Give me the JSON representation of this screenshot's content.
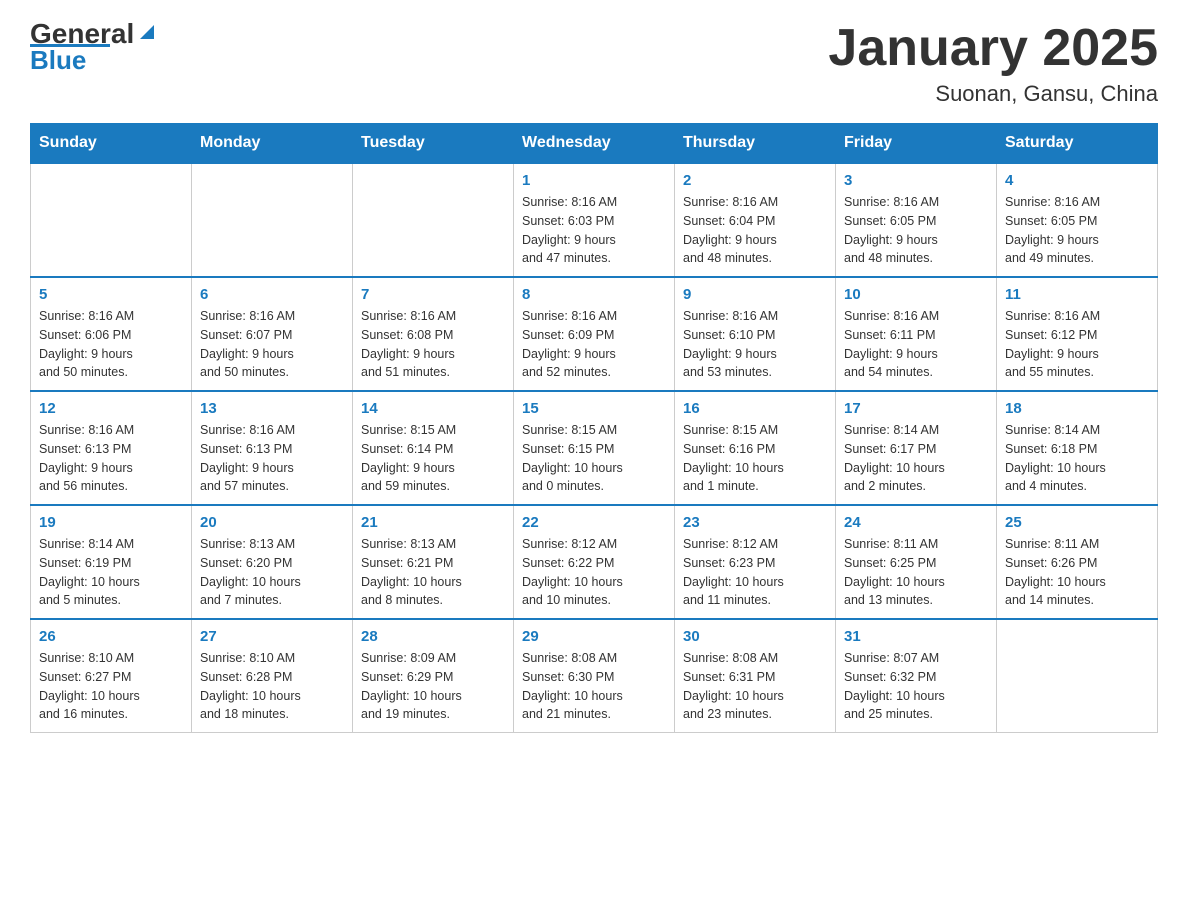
{
  "logo": {
    "text_general": "General",
    "text_blue": "Blue"
  },
  "title": "January 2025",
  "subtitle": "Suonan, Gansu, China",
  "weekdays": [
    "Sunday",
    "Monday",
    "Tuesday",
    "Wednesday",
    "Thursday",
    "Friday",
    "Saturday"
  ],
  "weeks": [
    [
      {
        "day": "",
        "info": ""
      },
      {
        "day": "",
        "info": ""
      },
      {
        "day": "",
        "info": ""
      },
      {
        "day": "1",
        "info": "Sunrise: 8:16 AM\nSunset: 6:03 PM\nDaylight: 9 hours\nand 47 minutes."
      },
      {
        "day": "2",
        "info": "Sunrise: 8:16 AM\nSunset: 6:04 PM\nDaylight: 9 hours\nand 48 minutes."
      },
      {
        "day": "3",
        "info": "Sunrise: 8:16 AM\nSunset: 6:05 PM\nDaylight: 9 hours\nand 48 minutes."
      },
      {
        "day": "4",
        "info": "Sunrise: 8:16 AM\nSunset: 6:05 PM\nDaylight: 9 hours\nand 49 minutes."
      }
    ],
    [
      {
        "day": "5",
        "info": "Sunrise: 8:16 AM\nSunset: 6:06 PM\nDaylight: 9 hours\nand 50 minutes."
      },
      {
        "day": "6",
        "info": "Sunrise: 8:16 AM\nSunset: 6:07 PM\nDaylight: 9 hours\nand 50 minutes."
      },
      {
        "day": "7",
        "info": "Sunrise: 8:16 AM\nSunset: 6:08 PM\nDaylight: 9 hours\nand 51 minutes."
      },
      {
        "day": "8",
        "info": "Sunrise: 8:16 AM\nSunset: 6:09 PM\nDaylight: 9 hours\nand 52 minutes."
      },
      {
        "day": "9",
        "info": "Sunrise: 8:16 AM\nSunset: 6:10 PM\nDaylight: 9 hours\nand 53 minutes."
      },
      {
        "day": "10",
        "info": "Sunrise: 8:16 AM\nSunset: 6:11 PM\nDaylight: 9 hours\nand 54 minutes."
      },
      {
        "day": "11",
        "info": "Sunrise: 8:16 AM\nSunset: 6:12 PM\nDaylight: 9 hours\nand 55 minutes."
      }
    ],
    [
      {
        "day": "12",
        "info": "Sunrise: 8:16 AM\nSunset: 6:13 PM\nDaylight: 9 hours\nand 56 minutes."
      },
      {
        "day": "13",
        "info": "Sunrise: 8:16 AM\nSunset: 6:13 PM\nDaylight: 9 hours\nand 57 minutes."
      },
      {
        "day": "14",
        "info": "Sunrise: 8:15 AM\nSunset: 6:14 PM\nDaylight: 9 hours\nand 59 minutes."
      },
      {
        "day": "15",
        "info": "Sunrise: 8:15 AM\nSunset: 6:15 PM\nDaylight: 10 hours\nand 0 minutes."
      },
      {
        "day": "16",
        "info": "Sunrise: 8:15 AM\nSunset: 6:16 PM\nDaylight: 10 hours\nand 1 minute."
      },
      {
        "day": "17",
        "info": "Sunrise: 8:14 AM\nSunset: 6:17 PM\nDaylight: 10 hours\nand 2 minutes."
      },
      {
        "day": "18",
        "info": "Sunrise: 8:14 AM\nSunset: 6:18 PM\nDaylight: 10 hours\nand 4 minutes."
      }
    ],
    [
      {
        "day": "19",
        "info": "Sunrise: 8:14 AM\nSunset: 6:19 PM\nDaylight: 10 hours\nand 5 minutes."
      },
      {
        "day": "20",
        "info": "Sunrise: 8:13 AM\nSunset: 6:20 PM\nDaylight: 10 hours\nand 7 minutes."
      },
      {
        "day": "21",
        "info": "Sunrise: 8:13 AM\nSunset: 6:21 PM\nDaylight: 10 hours\nand 8 minutes."
      },
      {
        "day": "22",
        "info": "Sunrise: 8:12 AM\nSunset: 6:22 PM\nDaylight: 10 hours\nand 10 minutes."
      },
      {
        "day": "23",
        "info": "Sunrise: 8:12 AM\nSunset: 6:23 PM\nDaylight: 10 hours\nand 11 minutes."
      },
      {
        "day": "24",
        "info": "Sunrise: 8:11 AM\nSunset: 6:25 PM\nDaylight: 10 hours\nand 13 minutes."
      },
      {
        "day": "25",
        "info": "Sunrise: 8:11 AM\nSunset: 6:26 PM\nDaylight: 10 hours\nand 14 minutes."
      }
    ],
    [
      {
        "day": "26",
        "info": "Sunrise: 8:10 AM\nSunset: 6:27 PM\nDaylight: 10 hours\nand 16 minutes."
      },
      {
        "day": "27",
        "info": "Sunrise: 8:10 AM\nSunset: 6:28 PM\nDaylight: 10 hours\nand 18 minutes."
      },
      {
        "day": "28",
        "info": "Sunrise: 8:09 AM\nSunset: 6:29 PM\nDaylight: 10 hours\nand 19 minutes."
      },
      {
        "day": "29",
        "info": "Sunrise: 8:08 AM\nSunset: 6:30 PM\nDaylight: 10 hours\nand 21 minutes."
      },
      {
        "day": "30",
        "info": "Sunrise: 8:08 AM\nSunset: 6:31 PM\nDaylight: 10 hours\nand 23 minutes."
      },
      {
        "day": "31",
        "info": "Sunrise: 8:07 AM\nSunset: 6:32 PM\nDaylight: 10 hours\nand 25 minutes."
      },
      {
        "day": "",
        "info": ""
      }
    ]
  ]
}
